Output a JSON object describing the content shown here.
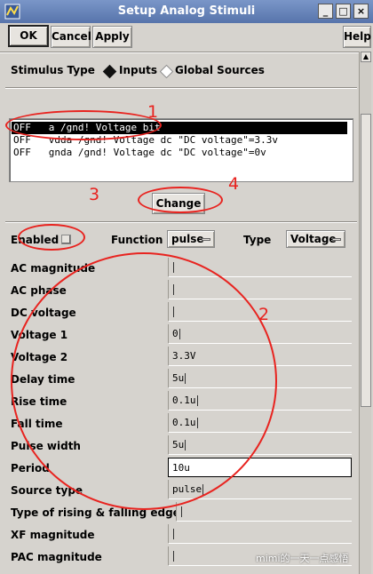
{
  "window": {
    "title": "Setup Analog Stimuli",
    "controls": [
      "_",
      "□",
      "×"
    ]
  },
  "toolbar": {
    "ok": "OK",
    "cancel": "Cancel",
    "apply": "Apply",
    "help": "Help"
  },
  "stimulus_type": {
    "label": "Stimulus Type",
    "options": [
      {
        "label": "Inputs",
        "selected": true
      },
      {
        "label": "Global Sources",
        "selected": false
      }
    ]
  },
  "stimuli_list": [
    {
      "text": "OFF   a /gnd! Voltage bit",
      "selected": true
    },
    {
      "text": "OFF   vdda /gnd! Voltage dc \"DC voltage\"=3.3v",
      "selected": false
    },
    {
      "text": "OFF   gnda /gnd! Voltage dc \"DC voltage\"=0v",
      "selected": false
    }
  ],
  "change_button": "Change",
  "settings": {
    "enabled_label": "Enabled",
    "enabled": false,
    "function_label": "Function",
    "function_value": "pulse",
    "type_label": "Type",
    "type_value": "Voltage"
  },
  "parameters": [
    {
      "label": "AC magnitude",
      "value": ""
    },
    {
      "label": "AC phase",
      "value": ""
    },
    {
      "label": "DC voltage",
      "value": ""
    },
    {
      "label": "Voltage 1",
      "value": "0"
    },
    {
      "label": "Voltage 2",
      "value": "3.3V"
    },
    {
      "label": "Delay time",
      "value": "5u"
    },
    {
      "label": "Rise time",
      "value": "0.1u"
    },
    {
      "label": "Fall time",
      "value": "0.1u"
    },
    {
      "label": "Pulse width",
      "value": "5u"
    },
    {
      "label": "Period",
      "value": "10u"
    },
    {
      "label": "Source type",
      "value": "pulse"
    },
    {
      "label": "Type of rising & falling edge",
      "value": ""
    },
    {
      "label": "XF magnitude",
      "value": ""
    },
    {
      "label": "PAC magnitude",
      "value": ""
    }
  ],
  "annotations": {
    "n1": "1",
    "n2": "2",
    "n3": "3",
    "n4": "4",
    "color": "#e8231f"
  },
  "watermark": "mimi的一天一点感悟"
}
